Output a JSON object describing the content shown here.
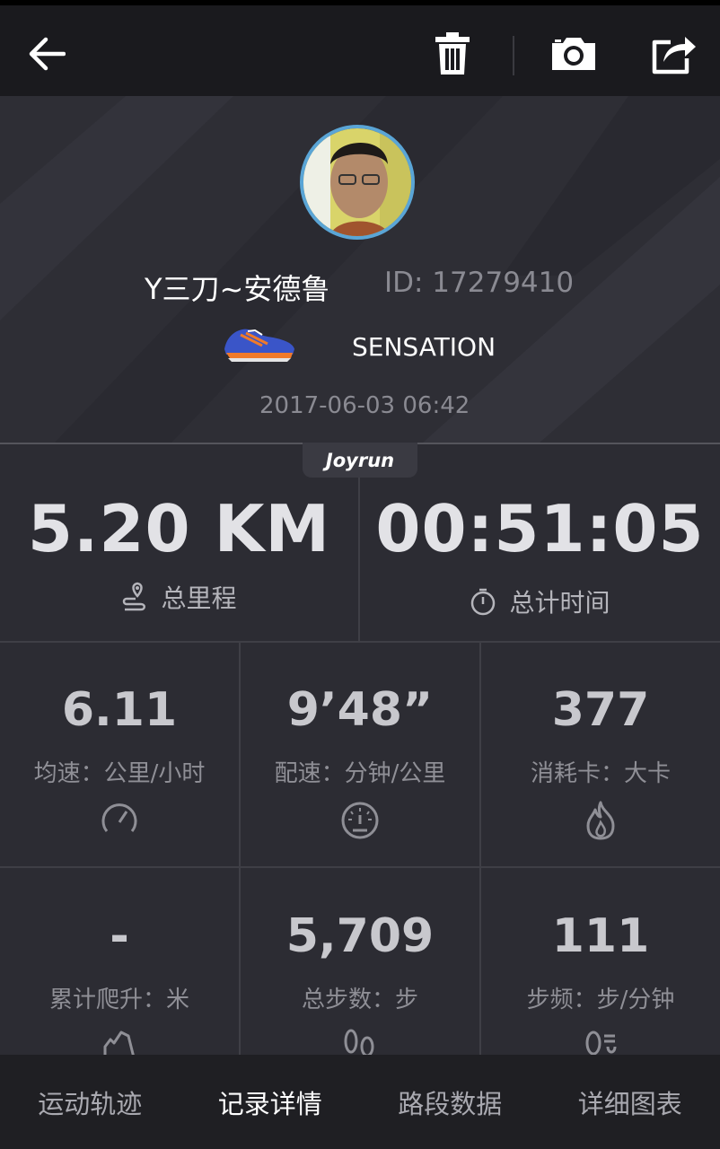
{
  "toolbar": {
    "back_icon": "arrow-left-icon",
    "delete_icon": "trash-icon",
    "camera_icon": "camera-icon",
    "share_icon": "share-icon"
  },
  "profile": {
    "name": "Y三刀~安德鲁",
    "id_text": "ID: 17279410",
    "shoe_name": "SENSATION",
    "datetime": "2017-06-03 06:42"
  },
  "badge": "Joyrun",
  "primary_stats": [
    {
      "value": "5.20 KM",
      "label": "总里程",
      "icon": "route-pin-icon"
    },
    {
      "value": "00:51:05",
      "label": "总计时间",
      "icon": "stopwatch-icon"
    }
  ],
  "stats": [
    {
      "value": "6.11",
      "label": "均速：公里/小时",
      "icon": "speedometer-icon"
    },
    {
      "value": "9’48”",
      "label": "配速：分钟/公里",
      "icon": "gauge-icon"
    },
    {
      "value": "377",
      "label": "消耗卡：大卡",
      "icon": "flame-icon"
    },
    {
      "value": "-",
      "label": "累计爬升：米",
      "icon": "climb-icon"
    },
    {
      "value": "5,709",
      "label": "总步数：步",
      "icon": "footprint-icon"
    },
    {
      "value": "111",
      "label": "步频：步/分钟",
      "icon": "cadence-icon"
    }
  ],
  "tabs": [
    {
      "label": "运动轨迹",
      "active": false
    },
    {
      "label": "记录详情",
      "active": true
    },
    {
      "label": "路段数据",
      "active": false
    },
    {
      "label": "详细图表",
      "active": false
    }
  ]
}
